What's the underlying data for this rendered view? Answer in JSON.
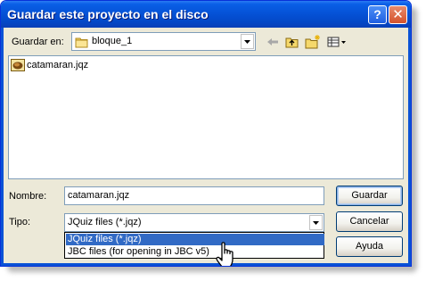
{
  "window": {
    "title": "Guardar este proyecto en el disco",
    "help_label": "?",
    "close_label": "✕"
  },
  "location": {
    "label": "Guardar en:",
    "value": "bloque_1",
    "toolbar_icons": [
      "back-arrow-icon",
      "up-folder-icon",
      "new-folder-icon",
      "view-menu-icon"
    ]
  },
  "files": [
    {
      "name": "catamaran.jqz",
      "icon": "jclic-file-icon"
    }
  ],
  "name_field": {
    "label": "Nombre:",
    "value": "catamaran.jqz"
  },
  "type_field": {
    "label": "Tipo:",
    "value": "JQuiz files (*.jqz)",
    "options": [
      "JQuiz files (*.jqz)",
      "JBC files (for opening in JBC v5)"
    ],
    "selected_index": 0
  },
  "buttons": {
    "save": "Guardar",
    "cancel": "Cancelar",
    "help": "Ayuda"
  },
  "colors": {
    "titlebar": "#0553d8",
    "selection": "#316ac5",
    "dialog_bg": "#ece9d8"
  }
}
